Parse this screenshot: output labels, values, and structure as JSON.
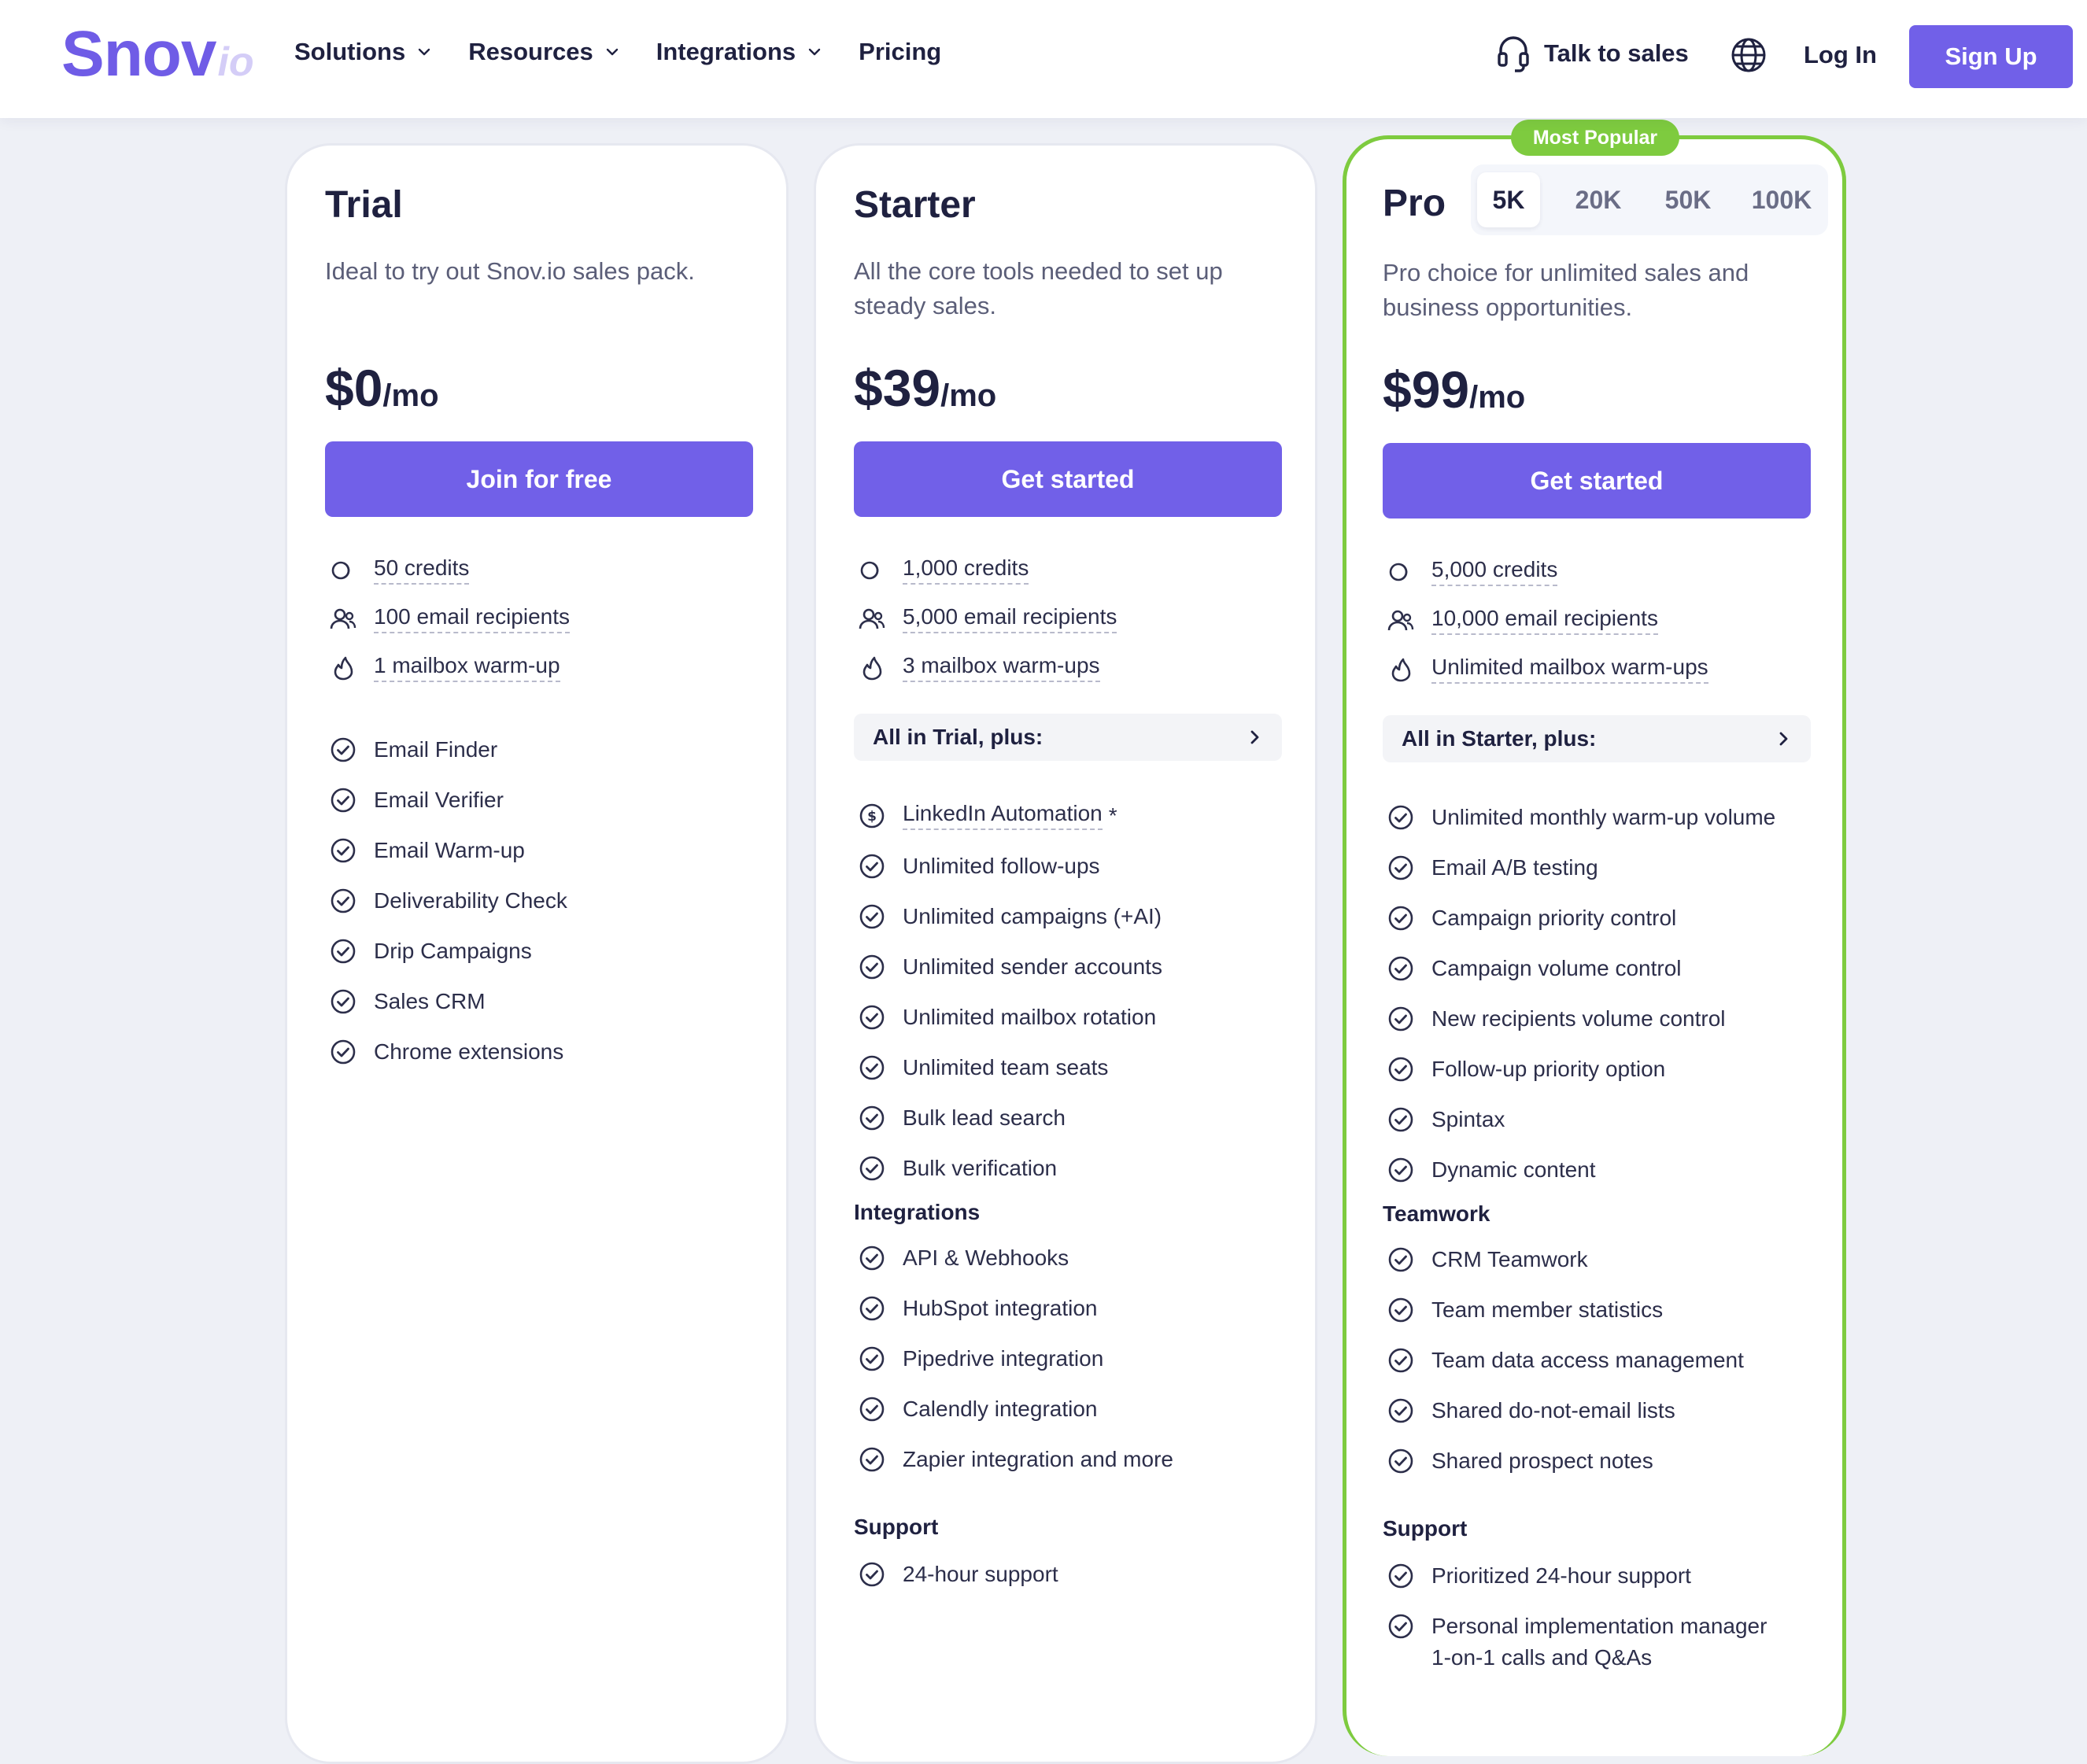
{
  "header": {
    "logo_main": "Snov",
    "logo_suffix": "io",
    "nav": [
      "Solutions",
      "Resources",
      "Integrations",
      "Pricing"
    ],
    "talk_to_sales": "Talk to sales",
    "login": "Log In",
    "signup": "Sign Up",
    "brand_color": "#7160e8"
  },
  "trial": {
    "title": "Trial",
    "desc": "Ideal to try out Snov.io sales pack.",
    "price": "$0",
    "per": "/mo",
    "button": "Join for free",
    "limits": [
      "50 credits",
      "100 email recipients",
      "1 mailbox warm-up"
    ],
    "features": [
      "Email Finder",
      "Email Verifier",
      "Email Warm-up",
      "Deliverability Check",
      "Drip Campaigns",
      "Sales CRM",
      "Chrome extensions"
    ]
  },
  "starter": {
    "title": "Starter",
    "desc": "All the core tools needed to set up steady sales.",
    "price": "$39",
    "per": "/mo",
    "button": "Get started",
    "limits": [
      "1,000 credits",
      "5,000 email recipients",
      "3 mailbox warm-ups"
    ],
    "plus": "All in Trial, plus:",
    "linkedin": "LinkedIn Automation",
    "linkedin_mark": "*",
    "features": [
      "Unlimited follow-ups",
      "Unlimited campaigns (+AI)",
      "Unlimited sender accounts",
      "Unlimited mailbox rotation",
      "Unlimited team seats",
      "Bulk lead search",
      "Bulk verification"
    ],
    "integrations_title": "Integrations",
    "integrations": [
      "API & Webhooks",
      "HubSpot integration",
      "Pipedrive integration",
      "Calendly integration",
      "Zapier integration and more"
    ],
    "support_title": "Support",
    "support": [
      "24-hour support"
    ]
  },
  "pro": {
    "badge": "Most Popular",
    "badge_color": "#7ecb3f",
    "title": "Pro",
    "tiers": [
      "5K",
      "20K",
      "50K",
      "100K"
    ],
    "active_tier": "5K",
    "desc": "Pro choice for unlimited sales and business opportunities.",
    "price": "$99",
    "per": "/mo",
    "button": "Get started",
    "limits": [
      "5,000 credits",
      "10,000 email recipients",
      "Unlimited mailbox warm-ups"
    ],
    "plus": "All in Starter, plus:",
    "features": [
      "Unlimited monthly warm-up volume",
      "Email A/B testing",
      "Campaign priority control",
      "Campaign volume control",
      "New recipients volume control",
      "Follow-up priority option",
      "Spintax",
      "Dynamic content"
    ],
    "teamwork_title": "Teamwork",
    "teamwork": [
      "CRM Teamwork",
      "Team member statistics",
      "Team data access management",
      "Shared do-not-email lists",
      "Shared prospect notes"
    ],
    "support_title": "Support",
    "support": [
      "Prioritized 24-hour support",
      "Personal implementation manager 1-on-1 calls and Q&As"
    ]
  }
}
